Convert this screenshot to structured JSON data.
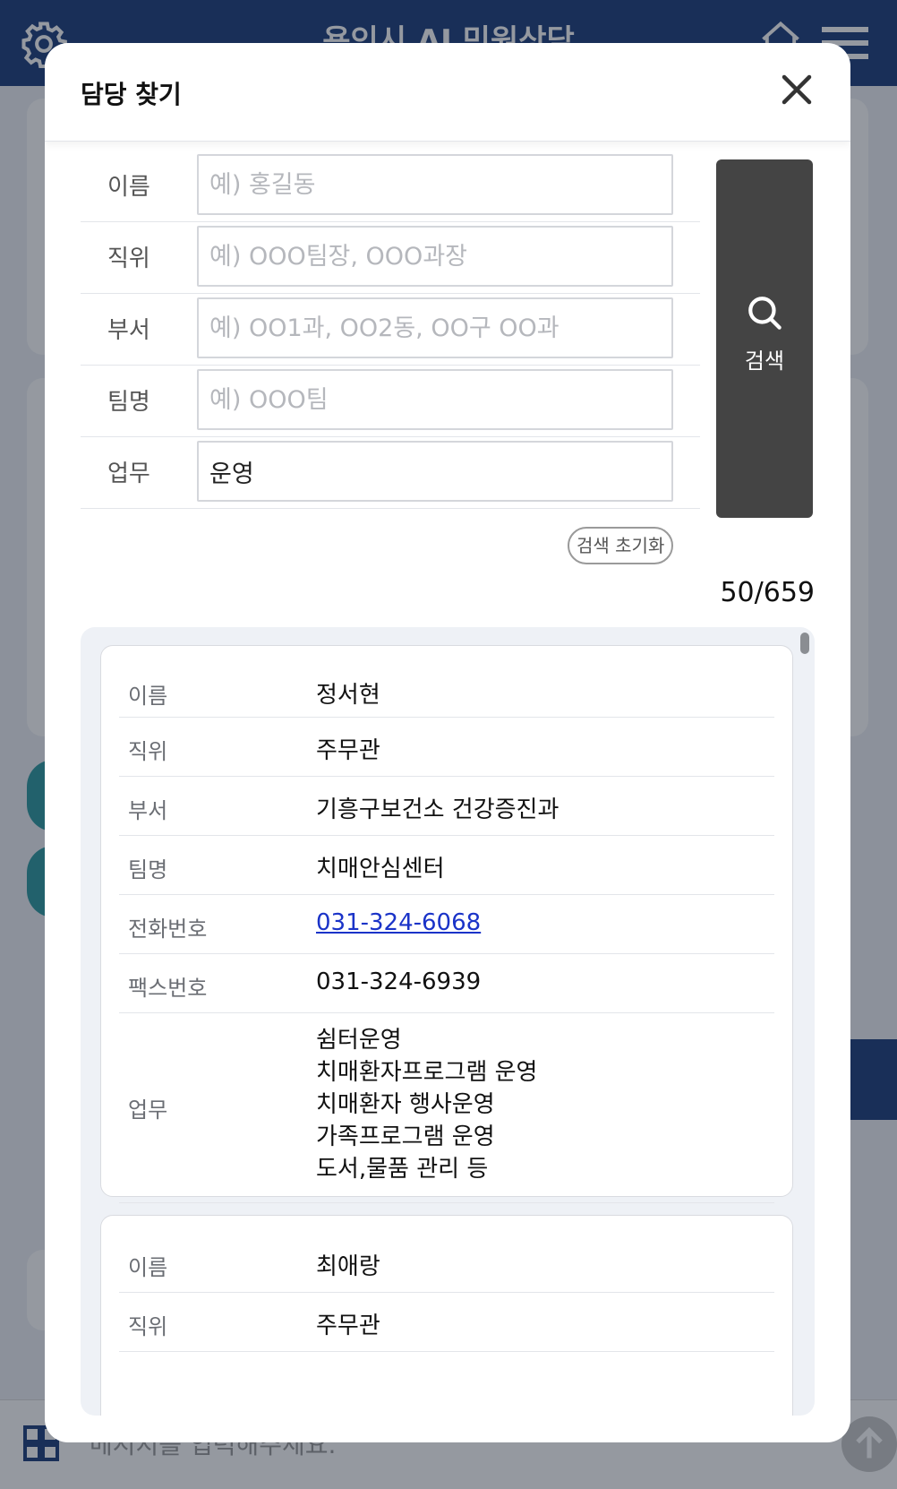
{
  "app": {
    "title": "용인시 AI 민원상담",
    "message_placeholder": "메시지를 입력해주세요."
  },
  "modal": {
    "title": "담당 찾기",
    "form": {
      "name": {
        "label": "이름",
        "placeholder": "예) 홍길동",
        "value": ""
      },
      "position": {
        "label": "직위",
        "placeholder": "예) OOO팀장, OOO과장",
        "value": ""
      },
      "department": {
        "label": "부서",
        "placeholder": "예) OO1과, OO2동, OO구 OO과",
        "value": ""
      },
      "team": {
        "label": "팀명",
        "placeholder": "예) OOO팀",
        "value": ""
      },
      "duty": {
        "label": "업무",
        "placeholder": "",
        "value": "운영"
      }
    },
    "search_label": "검색",
    "reset_label": "검색 초기화",
    "result_count": "50/659",
    "results": [
      {
        "name_label": "이름",
        "name": "정서현",
        "position_label": "직위",
        "position": "주무관",
        "department_label": "부서",
        "department": "기흥구보건소 건강증진과",
        "team_label": "팀명",
        "team": "치매안심센터",
        "phone_label": "전화번호",
        "phone": "031-324-6068",
        "fax_label": "팩스번호",
        "fax": "031-324-6939",
        "duty_label": "업무",
        "duties": [
          "쉼터운영",
          "치매환자프로그램 운영",
          "치매환자 행사운영",
          "가족프로그램 운영",
          "도서,물품 관리 등"
        ]
      },
      {
        "name_label": "이름",
        "name": "최애랑",
        "position_label": "직위",
        "position": "주무관"
      }
    ]
  }
}
